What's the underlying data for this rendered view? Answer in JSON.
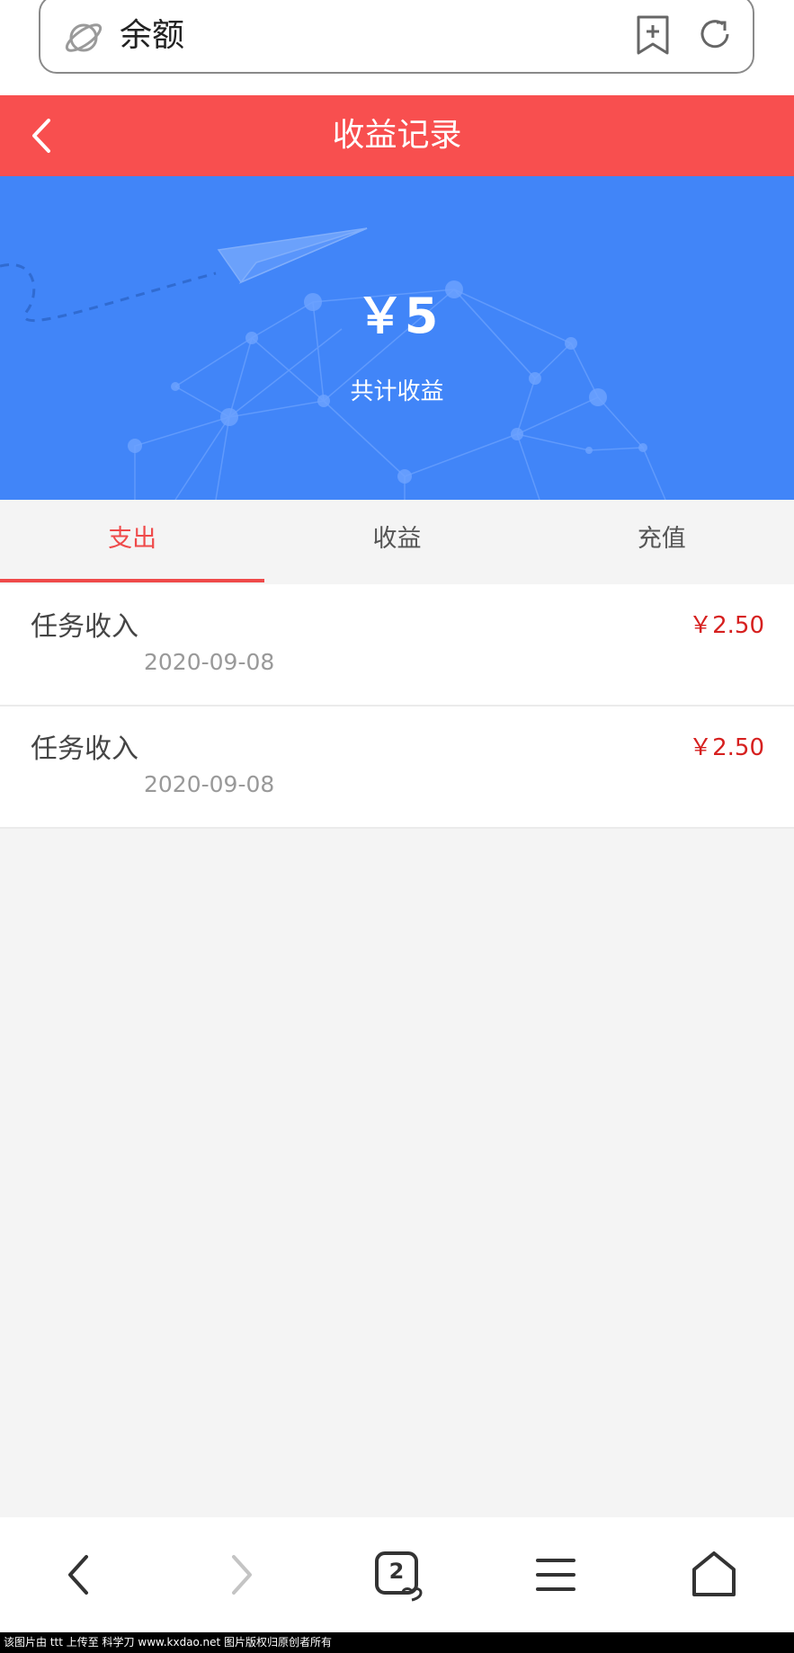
{
  "browser": {
    "address_text": "余额",
    "tab_count": "2"
  },
  "header": {
    "title": "收益记录"
  },
  "banner": {
    "total_amount": "￥5",
    "total_label": "共计收益"
  },
  "tabs": [
    {
      "label": "支出",
      "active": true
    },
    {
      "label": "收益",
      "active": false
    },
    {
      "label": "充值",
      "active": false
    }
  ],
  "records": [
    {
      "title": "任务收入",
      "date": "2020-09-08",
      "amount": "￥2.50"
    },
    {
      "title": "任务收入",
      "date": "2020-09-08",
      "amount": "￥2.50"
    }
  ],
  "footer_watermark": "该图片由 ttt 上传至 科学刀 www.kxdao.net 图片版权归原创者所有",
  "colors": {
    "header_red": "#f84f4f",
    "banner_blue": "#4185f8",
    "amount_red": "#d6201f",
    "tab_active": "#ef4a4a"
  }
}
